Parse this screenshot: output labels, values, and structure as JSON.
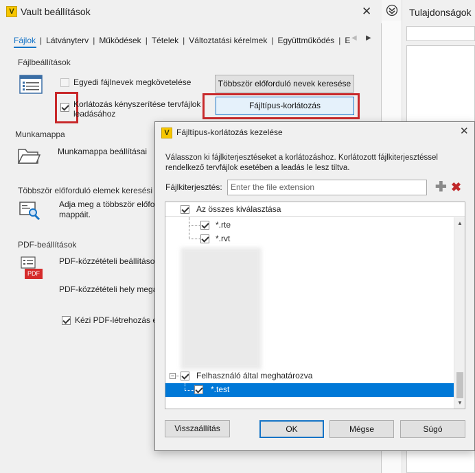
{
  "main_window": {
    "title": "Vault beállítások",
    "logo_letter": "V",
    "tabs": [
      "Fájlok",
      "Látványterv",
      "Működések",
      "Tételek",
      "Változtatási kérelmek",
      "Együttműködés",
      "E"
    ],
    "sections": {
      "file_settings": {
        "heading": "Fájlbeállítások",
        "unique_names_label": "Egyedi fájlnevek megkövetelése",
        "find_duplicates_button": "Többször előforduló nevek keresése",
        "enforce_line1": "Korlátozás kényszerítése tervfájlok",
        "enforce_line2": "leadásához",
        "filetype_button": "Fájltípus-korlátozás"
      },
      "workspace": {
        "heading": "Munkamappa",
        "text": "Munkamappa beállításai"
      },
      "duplicates": {
        "heading": "Többször előforduló elemek keresési b",
        "line1": "Adja meg a többször előfor",
        "line2": "mappáit."
      },
      "pdf": {
        "heading": "PDF-beállítások",
        "publish_settings": "PDF-közzétételi beállítások b",
        "publish_location": "PDF-közzétételi hely megad",
        "manual_pdf": "Kézi PDF-létrehozás en",
        "pdf_badge": "PDF"
      }
    }
  },
  "right_panel": {
    "title": "Tulajdonságok"
  },
  "dialog": {
    "title": "Fájltípus-korlátozás kezelése",
    "logo_letter": "V",
    "description_line1": "Válasszon ki fájlkiterjesztéseket a korlátozáshoz. Korlátozott fájlkiterjesztéssel",
    "description_line2": "rendelkező tervfájlok esetében a leadás le lesz tiltva.",
    "extension_label": "Fájlkiterjesztés:",
    "extension_placeholder": "Enter the file extension",
    "select_all": "Az összes kiválasztása",
    "tree_items": {
      "rte": "*.rte",
      "rvt": "*.rvt",
      "user_defined": "Felhasználó által meghatározva",
      "test": "*.test"
    },
    "buttons": {
      "reset": "Visszaállítás",
      "ok": "OK",
      "cancel": "Mégse",
      "help": "Súgó"
    }
  },
  "colors": {
    "accent": "#1473c6",
    "highlight": "#0078d7",
    "red_frame": "#c8282a",
    "add_icon": "#8a8a8a",
    "delete_icon": "#c0282a"
  }
}
